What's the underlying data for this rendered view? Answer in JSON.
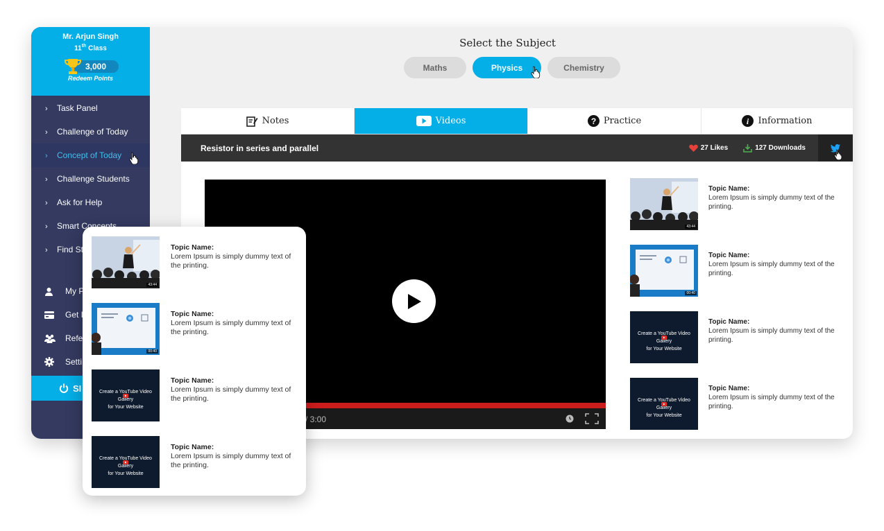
{
  "profile": {
    "name": "Mr. Arjun Singh",
    "class_num": "11",
    "class_sup": "th",
    "class_label": "Class",
    "points": "3,000",
    "redeem_label": "Redeem Points"
  },
  "sidebar": {
    "items": [
      {
        "label": "Task Panel"
      },
      {
        "label": "Challenge of Today"
      },
      {
        "label": "Concept of Today"
      },
      {
        "label": "Challenge Students"
      },
      {
        "label": "Ask for Help"
      },
      {
        "label": "Smart Concepts"
      },
      {
        "label": "Find St"
      }
    ],
    "active_index": 2,
    "secondary": [
      {
        "label": "My P",
        "icon": "user-icon"
      },
      {
        "label": "Get I",
        "icon": "card-icon"
      },
      {
        "label": "Refe",
        "icon": "group-icon"
      },
      {
        "label": "Setti",
        "icon": "gear-icon"
      }
    ],
    "signout_label": "SI"
  },
  "subjects": {
    "title": "Select the Subject",
    "options": [
      "Maths",
      "Physics",
      "Chemistry"
    ],
    "selected": "Physics"
  },
  "tabs": [
    {
      "label": "Notes",
      "icon": "notes-icon"
    },
    {
      "label": "Videos",
      "icon": "video-icon"
    },
    {
      "label": "Practice",
      "icon": "question-icon"
    },
    {
      "label": "Information",
      "icon": "info-icon"
    }
  ],
  "active_tab": "Videos",
  "video": {
    "title": "Resistor in series and parallel",
    "likes": "27 Likes",
    "downloads": "127 Downloads",
    "time": "/ 3:00"
  },
  "video_list": [
    {
      "topic": "Topic Name:",
      "desc": "Lorem Ipsum is simply dummy text of the printing.",
      "thumb": "lecture",
      "duration": "43:44"
    },
    {
      "topic": "Topic Name:",
      "desc": "Lorem Ipsum is simply dummy text of the printing.",
      "thumb": "slide",
      "duration": "00:40"
    },
    {
      "topic": "Topic Name:",
      "desc": "Lorem Ipsum is simply dummy text of the printing.",
      "thumb": "dark",
      "caption_line1": "Create a YouTube Video Gallery",
      "caption_line2": "for Your Website"
    },
    {
      "topic": "Topic Name:",
      "desc": "Lorem Ipsum is simply dummy text of the printing.",
      "thumb": "dark",
      "caption_line1": "Create a YouTube Video Gallery",
      "caption_line2": "for Your Website"
    }
  ],
  "colors": {
    "accent": "#04aee6",
    "sidebar_bg": "#343a60",
    "active_nav_text": "#3fc1ef",
    "progress_red": "#cc1d1d",
    "like_red": "#e8403a",
    "download_green": "#4caf50"
  }
}
